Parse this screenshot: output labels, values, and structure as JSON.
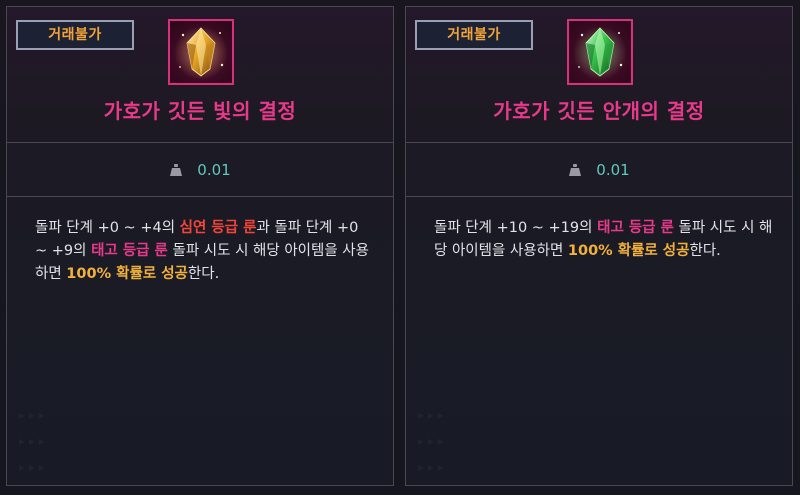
{
  "panels": [
    {
      "trade_badge": "거래불가",
      "icon": "golden-crystal-icon",
      "name": "가호가 깃든 빛의 결정",
      "weight_icon": "weight-icon",
      "weight": "0.01",
      "description": [
        {
          "text": "돌파 단계 +0 ~ +4의 ",
          "style": "normal"
        },
        {
          "text": "심연 등급 룬",
          "style": "red"
        },
        {
          "text": "과 돌파 단계 +0 ~ +9의 ",
          "style": "normal"
        },
        {
          "text": "태고 등급 룬",
          "style": "pink"
        },
        {
          "text": " 돌파 시도 시 해당 아이템을 사용하면 ",
          "style": "normal"
        },
        {
          "text": "100% 확률로 성공",
          "style": "gold"
        },
        {
          "text": "한다.",
          "style": "normal"
        }
      ]
    },
    {
      "trade_badge": "거래불가",
      "icon": "green-crystal-icon",
      "name": "가호가 깃든 안개의 결정",
      "weight_icon": "weight-icon",
      "weight": "0.01",
      "description": [
        {
          "text": "돌파 단계 +10 ~ +19의 ",
          "style": "normal"
        },
        {
          "text": "태고 등급 룬",
          "style": "pink"
        },
        {
          "text": " 돌파 시도 시 해당 아이템을 사용하면 ",
          "style": "normal"
        },
        {
          "text": "100% 확률로 성공",
          "style": "gold"
        },
        {
          "text": "한다.",
          "style": "normal"
        }
      ]
    }
  ],
  "colors": {
    "name": "#e8398b",
    "badge_text": "#f3a43a",
    "weight": "#5fc9c0",
    "red": "#f0463a",
    "pink": "#e8398b",
    "gold": "#f1b13c"
  }
}
